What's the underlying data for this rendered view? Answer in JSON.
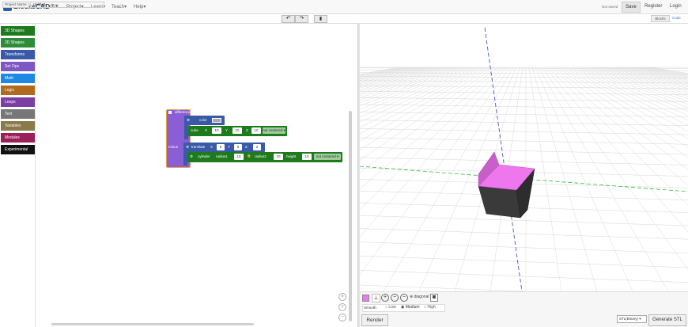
{
  "app": {
    "name": "BlocksCAD"
  },
  "nav": {
    "project": "Project",
    "learn": "Learn",
    "teach": "Teach",
    "help": "Help",
    "caret": "▾"
  },
  "user": {
    "status": "Not saved",
    "save": "Save",
    "register": "Register",
    "login": "Login"
  },
  "project": {
    "label": "Project Name",
    "value": "Untitled"
  },
  "toolbar": {
    "undo": "↶",
    "redo": "↷",
    "trash": "🗑"
  },
  "tabs": {
    "blocks": "Blocks",
    "code": "Code"
  },
  "categories": [
    {
      "label": "3D Shapes",
      "color": "#1d7a1d"
    },
    {
      "label": "2D Shapes",
      "color": "#2e8b3a"
    },
    {
      "label": "Transforms",
      "color": "#3a5aa8"
    },
    {
      "label": "Set Ops",
      "color": "#7e57c2"
    },
    {
      "label": "Math",
      "color": "#1e88e5"
    },
    {
      "label": "Logic",
      "color": "#b06a1f"
    },
    {
      "label": "Loops",
      "color": "#7b3fa3"
    },
    {
      "label": "Text",
      "color": "#777777"
    },
    {
      "label": "Variables",
      "color": "#8a7a4a"
    },
    {
      "label": "Modules",
      "color": "#9c1f5a"
    },
    {
      "label": "Experimental",
      "color": "#111111"
    }
  ],
  "blocks": {
    "difference": "difference",
    "minus": "minus",
    "color_label": "color",
    "cube": {
      "label": "cube",
      "x_lbl": "X",
      "x": "10",
      "y_lbl": "Y",
      "y": "10",
      "z_lbl": "Z",
      "z": "10",
      "mode": "not centered ▾"
    },
    "translate": {
      "label": "translate",
      "x_lbl": "X",
      "x": "0",
      "y_lbl": "Y",
      "y": "5",
      "z_lbl": "Z",
      "z": "2"
    },
    "cylinder": {
      "label": "cylinder",
      "r1_lbl": "radius1",
      "r1": "10",
      "r2_lbl": "radius2",
      "r2": "10",
      "h_lbl": "height",
      "h": "10",
      "mode": "not centered ▾"
    }
  },
  "viewer": {
    "view_select": "diagonal ▾",
    "smooth_label": "Smooth:",
    "smooth_options": [
      "Low",
      "Medium",
      "High"
    ],
    "smooth_selected": "Medium",
    "render": "Render",
    "stl_format": "STL(Binary) ▾",
    "generate": "Generate STL",
    "object_color": "#ee77ee"
  },
  "zoom": {
    "reset": "⌖",
    "in": "+",
    "out": "−"
  }
}
